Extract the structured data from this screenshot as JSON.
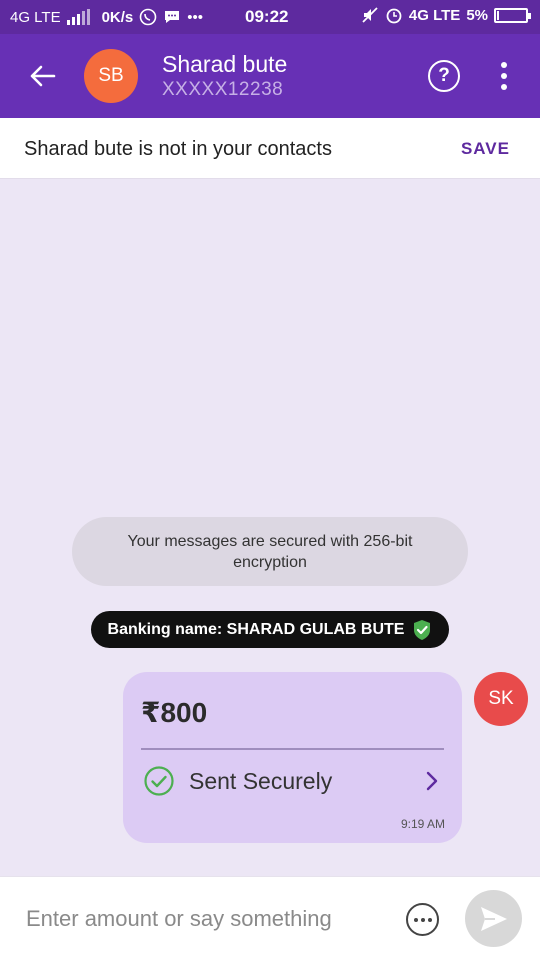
{
  "status_bar": {
    "network_left": "4G LTE",
    "data_speed": "0K/s",
    "time": "09:22",
    "network_right": "4G LTE",
    "battery": "5%",
    "icons": [
      "signal-icon",
      "whatsapp-icon",
      "chat-bubble-icon",
      "more-notifications-icon",
      "mute-icon",
      "alarm-icon",
      "battery-icon"
    ]
  },
  "header": {
    "avatar_initials": "SB",
    "avatar_color": "#f46c3d",
    "contact_name": "Sharad bute",
    "contact_number": "XXXXX12238",
    "icons": [
      "back-arrow-icon",
      "help-icon",
      "more-vert-icon"
    ]
  },
  "contact_banner": {
    "text": "Sharad bute is not in your contacts",
    "save_label": "SAVE"
  },
  "chat": {
    "encryption_note": "Your messages are secured with 256-bit encryption",
    "banking_name": "Banking name: SHARAD GULAB BUTE",
    "payment": {
      "amount": "₹800",
      "status": "Sent Securely",
      "time": "9:19 AM"
    },
    "self_avatar_initials": "SK",
    "self_avatar_color": "#e84b4b"
  },
  "input_bar": {
    "placeholder": "Enter amount or say something",
    "icons": [
      "options-icon",
      "send-icon"
    ]
  },
  "colors": {
    "brand_purple": "#6730b5",
    "status_purple": "#5e2a9f",
    "chat_background": "#ece6f5",
    "success_green": "#4caf50"
  }
}
